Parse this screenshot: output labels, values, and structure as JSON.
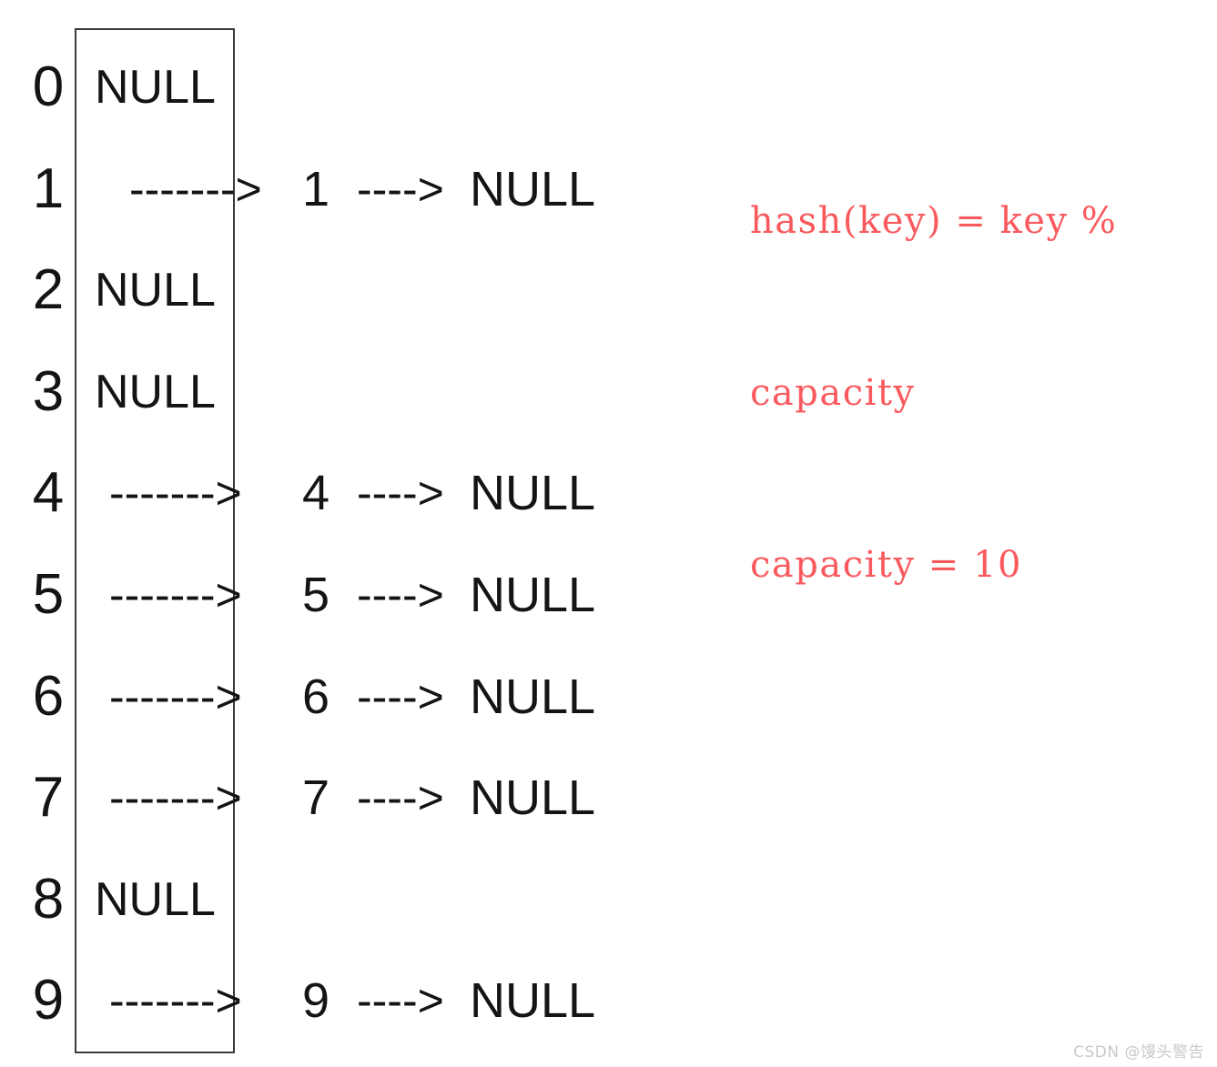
{
  "diagram": {
    "title": "hash-table-separate-chaining",
    "box": {
      "label": "bucket-array"
    },
    "null_text": "NULL",
    "arrow_long": "------->",
    "arrow_short": "---->",
    "rows": [
      {
        "index": "0",
        "kind": "empty",
        "bucket_text": "NULL"
      },
      {
        "index": "1",
        "kind": "chain",
        "arrow_long": "------->",
        "key": "1",
        "arrow_short": "---->",
        "tail": "NULL"
      },
      {
        "index": "2",
        "kind": "empty",
        "bucket_text": "NULL"
      },
      {
        "index": "3",
        "kind": "empty",
        "bucket_text": "NULL"
      },
      {
        "index": "4",
        "kind": "chain",
        "arrow_long": "------->",
        "key": "4",
        "arrow_short": "---->",
        "tail": "NULL"
      },
      {
        "index": "5",
        "kind": "chain",
        "arrow_long": "------->",
        "key": "5",
        "arrow_short": "---->",
        "tail": "NULL"
      },
      {
        "index": "6",
        "kind": "chain",
        "arrow_long": "------->",
        "key": "6",
        "arrow_short": "---->",
        "tail": "NULL"
      },
      {
        "index": "7",
        "kind": "chain",
        "arrow_long": "------->",
        "key": "7",
        "arrow_short": "---->",
        "tail": "NULL"
      },
      {
        "index": "8",
        "kind": "empty",
        "bucket_text": "NULL"
      },
      {
        "index": "9",
        "kind": "chain",
        "arrow_long": "------->",
        "key": "9",
        "arrow_short": "---->",
        "tail": "NULL"
      }
    ]
  },
  "annotation": {
    "color": "#fa5a5e",
    "lines": [
      "hash(key) = key %",
      "capacity",
      "capacity = 10"
    ]
  },
  "watermark": {
    "text": "CSDN @馒头警告",
    "color": "#c9c9c9"
  }
}
